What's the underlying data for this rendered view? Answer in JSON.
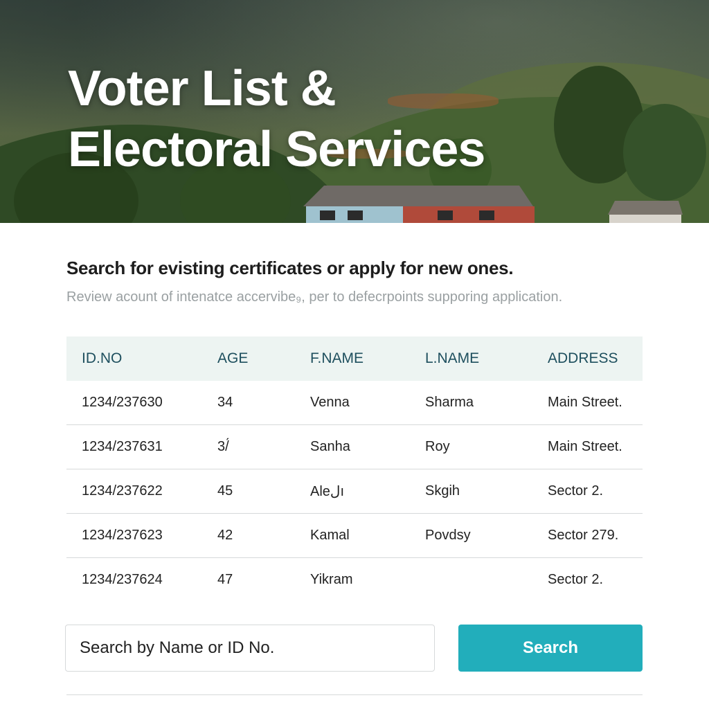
{
  "hero": {
    "title_line1": "Voter List &",
    "title_line2": "Electoral Services"
  },
  "intro": {
    "heading": "Search for evisting certificates or apply for new ones.",
    "subtext": "Review acount of intenatce accervibe₉, per to defecrpoints supporing application."
  },
  "table": {
    "columns": [
      "ID.NO",
      "AGE",
      "F.NAME",
      "L.NAME",
      "ADDRESS"
    ],
    "rows": [
      [
        "1234/237630",
        "34",
        "Venna",
        "Sharma",
        "Main Street."
      ],
      [
        "1234/237631",
        "3/́",
        "Sanha",
        "Roy",
        "Main Street."
      ],
      [
        "1234/237622",
        "45",
        "Aleلı",
        "Skgih",
        "Sector 2."
      ],
      [
        "1234/237623",
        "42",
        "Kamal",
        "Povdsy",
        "Sector 279."
      ],
      [
        "1234/237624",
        "47",
        "Yikram",
        "",
        "Sector 2."
      ]
    ]
  },
  "search": {
    "placeholder": "Search by Name or ID No.",
    "button_label": "Search"
  },
  "colors": {
    "accent": "#22aebb",
    "header_bg": "#edf4f2",
    "header_text": "#1e4f5e"
  }
}
